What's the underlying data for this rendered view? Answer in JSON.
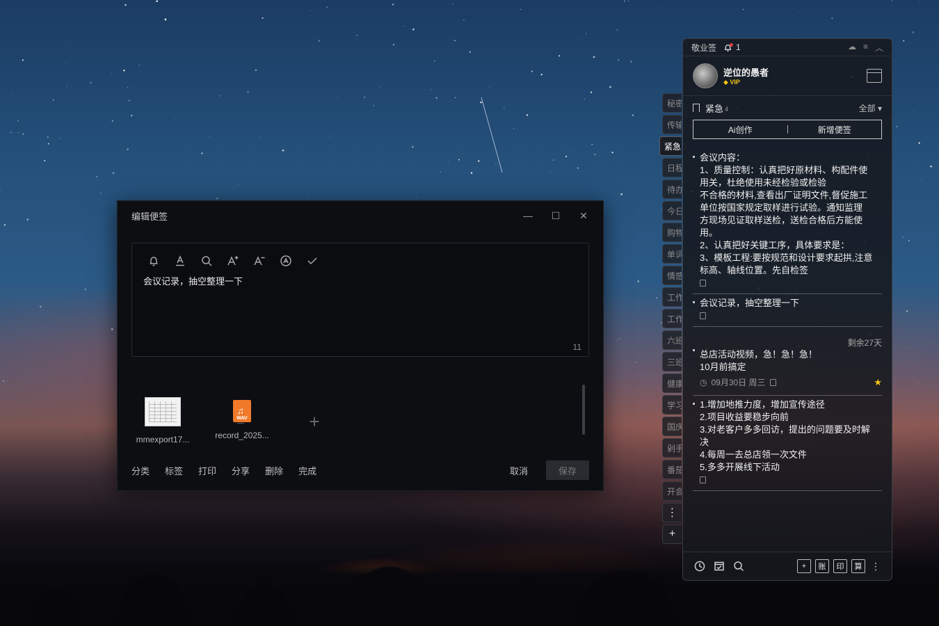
{
  "editor": {
    "title": "编辑便签",
    "window_controls": [
      "—",
      "☐",
      "✕"
    ],
    "toolbar_icons": [
      "bell-icon",
      "text-color-icon",
      "search-icon",
      "font-increase-icon",
      "font-decrease-icon",
      "auto-format-icon",
      "check-icon"
    ],
    "content": "会议记录，抽空整理一下",
    "char_count": "11",
    "attachments": [
      {
        "name": "mmexport17...",
        "type": "image"
      },
      {
        "name": "record_2025...",
        "type": "wav",
        "badge": "WAV"
      }
    ],
    "add_symbol": "+",
    "actions": [
      "分类",
      "标签",
      "打印",
      "分享",
      "删除",
      "完成"
    ],
    "cancel": "取消",
    "save": "保存"
  },
  "sidetabs": [
    "秘密",
    "传输",
    "紧急",
    "日程",
    "待办",
    "今日",
    "购物",
    "单词",
    "情感",
    "工作",
    "工作",
    "六班",
    "三班",
    "健康",
    "学习",
    "国庆",
    "剁手",
    "番茄",
    "开会"
  ],
  "sidetabs_active": "紧急",
  "sidetabs_more": "⋮",
  "sidetabs_add": "+",
  "panel": {
    "app_name": "敬业签",
    "notif_count": "1",
    "username": "逆位的愚者",
    "vip": "VIP",
    "category": "紧急",
    "category_count": "4",
    "filter": "全部 ▾",
    "ai_btn": "Ai创作",
    "add_btn": "新增便签",
    "notes": [
      {
        "lines": [
          "会议内容：",
          "1、质量控制：认真把好原材料、构配件使",
          "用关，杜绝使用未经检验或检验",
          "不合格的材料,查看出厂证明文件,督促施工",
          "单位按国家规定取样进行试验。通知监理",
          "方现场见证取样送检，送检合格后方能使",
          "用。",
          "2、认真把好关键工序，具体要求是：",
          "3、模板工程:要按规范和设计要求起拱,注意",
          "标高、轴线位置。先自检签"
        ]
      },
      {
        "lines": [
          "会议记录，抽空整理一下"
        ]
      },
      {
        "remaining": "剩余27天",
        "lines": [
          "总店活动视频，急！急！急！",
          "10月前搞定"
        ],
        "date": "09月30日 周三",
        "starred": true
      },
      {
        "lines": [
          "1.增加地推力度，增加宣传途径",
          "2.项目收益要稳步向前",
          "3.对老客户多多回访，提出的问题要及时解",
          "决",
          "4.每周一去总店领一次文件",
          "5.多多开展线下活动"
        ]
      }
    ],
    "bottom_right": [
      "+",
      "账",
      "印",
      "算"
    ]
  }
}
